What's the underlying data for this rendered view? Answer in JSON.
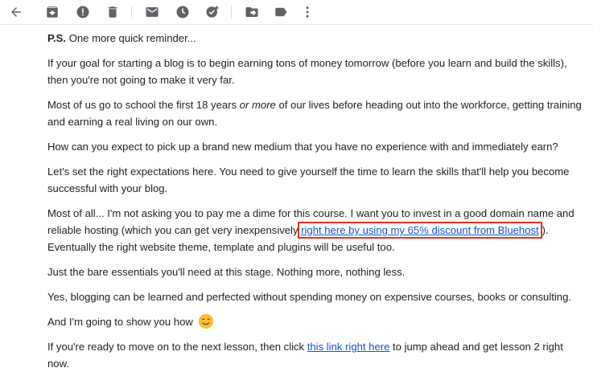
{
  "toolbar": {
    "icons": [
      "back-arrow-icon",
      "archive-icon",
      "report-spam-icon",
      "delete-icon",
      "mark-unread-icon",
      "snooze-icon",
      "add-to-tasks-icon",
      "move-to-icon",
      "label-icon",
      "more-options-icon"
    ]
  },
  "email": {
    "ps_label": "P.S.",
    "ps_text": " One more quick reminder...",
    "para1": "If your goal for starting a blog is to begin earning tons of money tomorrow (before you learn and build the skills), then you're not going to make it very far.",
    "para2_a": "Most of us go to school the first 18 years ",
    "para2_em": "or more",
    "para2_b": " of our lives before heading out into the workforce, getting training and earning a real living on our own.",
    "para3": "How can you expect to pick up a brand new medium that you have no experience with and immediately earn?",
    "para4": "Let's set the right expectations here. You need to give yourself the time to learn the skills that'll help you become successful with your blog.",
    "para5_a": "Most of all... I'm not asking you to pay me a dime for this course. I want you to invest in a good domain name and reliable hosting (which you can get very inexpensively ",
    "para5_link": "right here by using my 65% discount from Bluehost",
    "para5_b": "). Eventually the right website theme, template and plugins will be useful too.",
    "para6": "Just the bare essentials you'll need at this stage. Nothing more, nothing less.",
    "para7": "Yes, blogging can be learned and perfected without spending money on expensive courses, books or consulting.",
    "para8": "And I'm going to show you how",
    "para8_emoji": "smiling-face-icon",
    "para9_a": "If you're ready to move on to the next lesson, then click ",
    "para9_link": "this link right here",
    "para9_b": " to jump ahead and get lesson 2 right now."
  },
  "colors": {
    "link": "#1155cc",
    "highlight_border": "#e0301e",
    "icon": "#5f6368",
    "emoji_fill": "#fbc02d"
  }
}
